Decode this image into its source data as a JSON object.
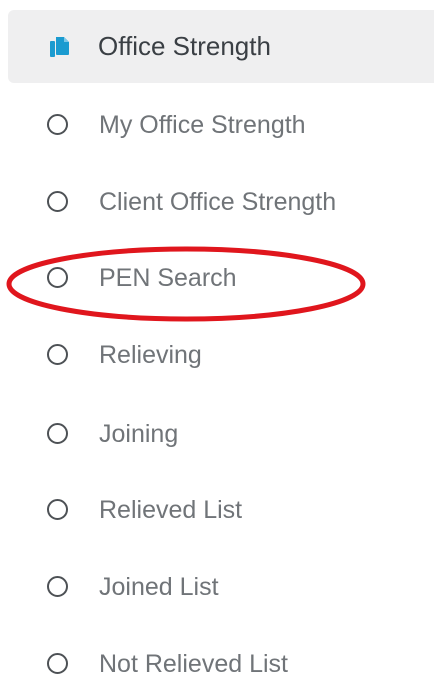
{
  "menu": {
    "header": {
      "label": "Office Strength",
      "icon": "copy-document-icon",
      "icon_color": "#1b9bd0"
    },
    "items": [
      {
        "label": "My Office Strength",
        "icon": "radio-circle-icon"
      },
      {
        "label": "Client Office Strength",
        "icon": "radio-circle-icon"
      },
      {
        "label": "PEN Search",
        "icon": "radio-circle-icon"
      },
      {
        "label": "Relieving",
        "icon": "radio-circle-icon"
      },
      {
        "label": "Joining",
        "icon": "radio-circle-icon"
      },
      {
        "label": "Relieved List",
        "icon": "radio-circle-icon"
      },
      {
        "label": "Joined List",
        "icon": "radio-circle-icon"
      },
      {
        "label": "Not Relieved List",
        "icon": "radio-circle-icon"
      }
    ]
  },
  "annotation": {
    "highlighted_item": "PEN Search",
    "color": "#e0161d"
  }
}
